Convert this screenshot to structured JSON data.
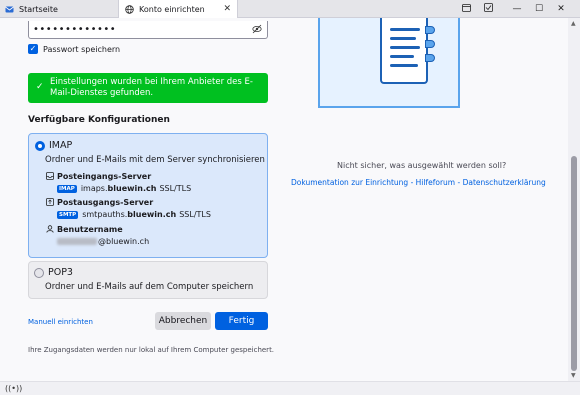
{
  "tabs": [
    {
      "label": "Startseite",
      "icon": "thunderbird-icon"
    },
    {
      "label": "Konto einrichten",
      "icon": "globe-icon"
    }
  ],
  "window_controls": {
    "minimize": "—",
    "maximize": "☐",
    "close": "✕"
  },
  "password": {
    "value": "•••••••••••••",
    "remember_label": "Passwort speichern",
    "remember_checked": true
  },
  "success_message": "Einstellungen wurden bei Ihrem Anbieter des E-Mail-Dienstes gefunden.",
  "configs_title": "Verfügbare Konfigurationen",
  "imap": {
    "title": "IMAP",
    "description": "Ordner und E-Mails mit dem Server synchronisieren",
    "incoming_label": "Posteingangs-Server",
    "incoming_pill": "IMAP",
    "incoming_host_prefix": "imaps.",
    "incoming_host_bold": "bluewin.ch",
    "incoming_security": "SSL/TLS",
    "outgoing_label": "Postausgangs-Server",
    "outgoing_pill": "SMTP",
    "outgoing_host_prefix": "smtpauths.",
    "outgoing_host_bold": "bluewin.ch",
    "outgoing_security": "SSL/TLS",
    "username_label": "Benutzername",
    "username_domain": "@bluewin.ch"
  },
  "pop3": {
    "title": "POP3",
    "description": "Ordner und E-Mails auf dem Computer speichern"
  },
  "manual_link": "Manuell einrichten",
  "buttons": {
    "cancel": "Abbrechen",
    "done": "Fertig"
  },
  "footnote": "Ihre Zugangsdaten werden nur lokal auf Ihrem Computer gespeichert.",
  "help": {
    "question": "Nicht sicher, was ausgewählt werden soll?",
    "link_docs": "Dokumentation zur Einrichtung",
    "link_forum": "Hilfeforum",
    "link_privacy": "Datenschutzerklärung",
    "separator": " - "
  },
  "colors": {
    "accent": "#0061e0",
    "success": "#00c020",
    "selected_bg": "#dbe8fb"
  }
}
